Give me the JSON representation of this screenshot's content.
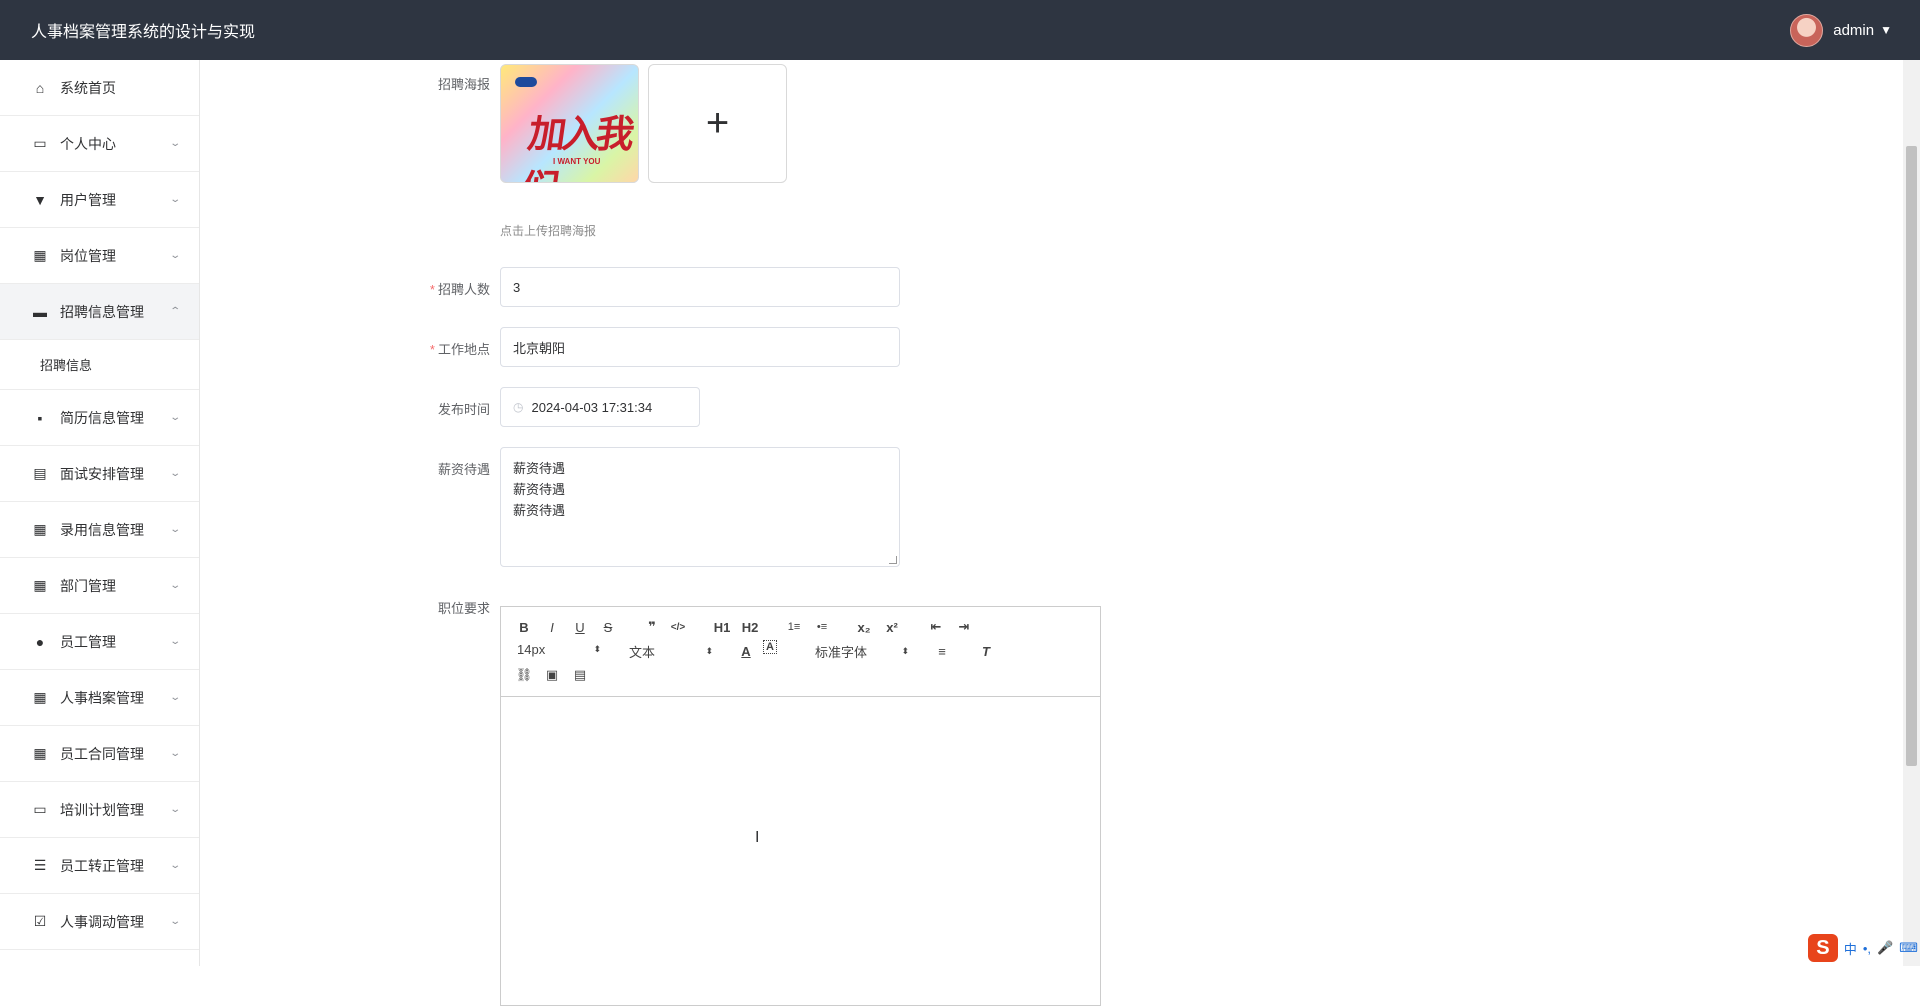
{
  "app": {
    "title": "人事档案管理系统的设计与实现"
  },
  "user": {
    "name": "admin"
  },
  "sidebar": {
    "items": [
      {
        "label": "系统首页",
        "icon": "home-icon"
      },
      {
        "label": "个人中心",
        "icon": "card-icon"
      },
      {
        "label": "用户管理",
        "icon": "brush-icon"
      },
      {
        "label": "岗位管理",
        "icon": "grid-icon"
      },
      {
        "label": "招聘信息管理",
        "icon": "briefcase-icon"
      },
      {
        "label": "简历信息管理",
        "icon": "chat-icon"
      },
      {
        "label": "面试安排管理",
        "icon": "clipboard-icon"
      },
      {
        "label": "录用信息管理",
        "icon": "grid-icon"
      },
      {
        "label": "部门管理",
        "icon": "grid-icon"
      },
      {
        "label": "员工管理",
        "icon": "leaf-icon"
      },
      {
        "label": "人事档案管理",
        "icon": "apps-icon"
      },
      {
        "label": "员工合同管理",
        "icon": "grid-icon"
      },
      {
        "label": "培训计划管理",
        "icon": "monitor-icon"
      },
      {
        "label": "员工转正管理",
        "icon": "list-icon"
      },
      {
        "label": "人事调动管理",
        "icon": "checklist-icon"
      }
    ],
    "submenu": {
      "label": "招聘信息"
    }
  },
  "form": {
    "poster": {
      "label": "招聘海报",
      "hint": "点击上传招聘海报",
      "thumb_text": "加入我们",
      "thumb_sub": "I WANT YOU"
    },
    "headcount": {
      "label": "招聘人数",
      "value": "3"
    },
    "location": {
      "label": "工作地点",
      "value": "北京朝阳"
    },
    "publish_time": {
      "label": "发布时间",
      "value": "2024-04-03 17:31:34"
    },
    "salary": {
      "label": "薪资待遇",
      "lines": [
        "薪资待遇",
        "薪资待遇",
        "薪资待遇"
      ]
    },
    "requirements": {
      "label": "职位要求"
    }
  },
  "editor": {
    "font_size": "14px",
    "heading": "文本",
    "font_family": "标准字体",
    "buttons": [
      "B",
      "I",
      "U",
      "S",
      "❞",
      "</>",
      "H1",
      "H2",
      "1≡",
      "•≡",
      "x₂",
      "x²",
      "⇤",
      "⇥"
    ]
  },
  "ime": {
    "labels": [
      "S",
      "中",
      "•,",
      "🎤",
      "⌨"
    ]
  }
}
